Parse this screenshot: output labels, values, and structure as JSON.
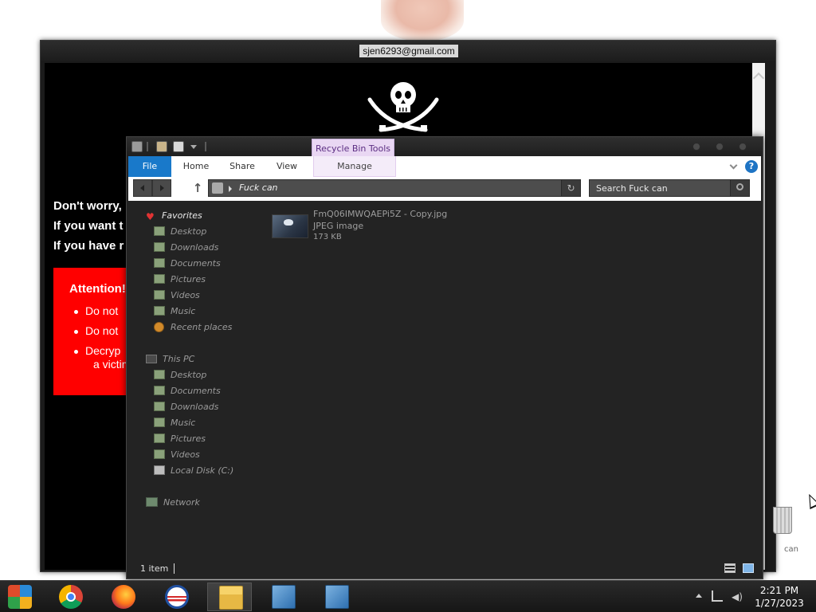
{
  "ransom_window": {
    "title": "sjen6293@gmail.com",
    "lines": [
      "Don't worry,",
      "If you want t",
      "If you have r"
    ],
    "attention": {
      "title": "Attention!",
      "items": [
        "Do not",
        "Do not",
        "Decryp"
      ],
      "continuation": "a victim"
    }
  },
  "explorer": {
    "contextual_tab_header": "Recycle Bin Tools",
    "ribbon_tabs": [
      "File",
      "Home",
      "Share",
      "View",
      "Manage"
    ],
    "help_label": "?",
    "address_path": "Fuck can",
    "search_placeholder": "Search Fuck can",
    "nav": {
      "favorites_label": "Favorites",
      "favorites": [
        "Desktop",
        "Downloads",
        "Documents",
        "Pictures",
        "Videos",
        "Music",
        "Recent places"
      ],
      "this_pc_label": "This PC",
      "this_pc": [
        "Desktop",
        "Documents",
        "Downloads",
        "Music",
        "Pictures",
        "Videos",
        "Local Disk (C:)"
      ],
      "network_label": "Network"
    },
    "files": [
      {
        "name": "FmQ06IMWQAEPi5Z - Copy.jpg",
        "type": "JPEG image",
        "size": "173 KB"
      }
    ],
    "status": {
      "item_count": "1 item"
    }
  },
  "desktop": {
    "recycle_bin_label": "can"
  },
  "taskbar": {
    "apps": [
      "ie-icon",
      "chrome-icon",
      "firefox-icon",
      "obama-icon",
      "file-explorer-icon",
      "installer-icon",
      "installer-icon"
    ],
    "clock": {
      "time": "2:21 PM",
      "date": "1/27/2023"
    }
  },
  "colors": {
    "file_tab": "#1979ca",
    "context_tab": "#e9d7f3",
    "ransom_red": "#ff0000",
    "explorer_bg": "#232323"
  }
}
